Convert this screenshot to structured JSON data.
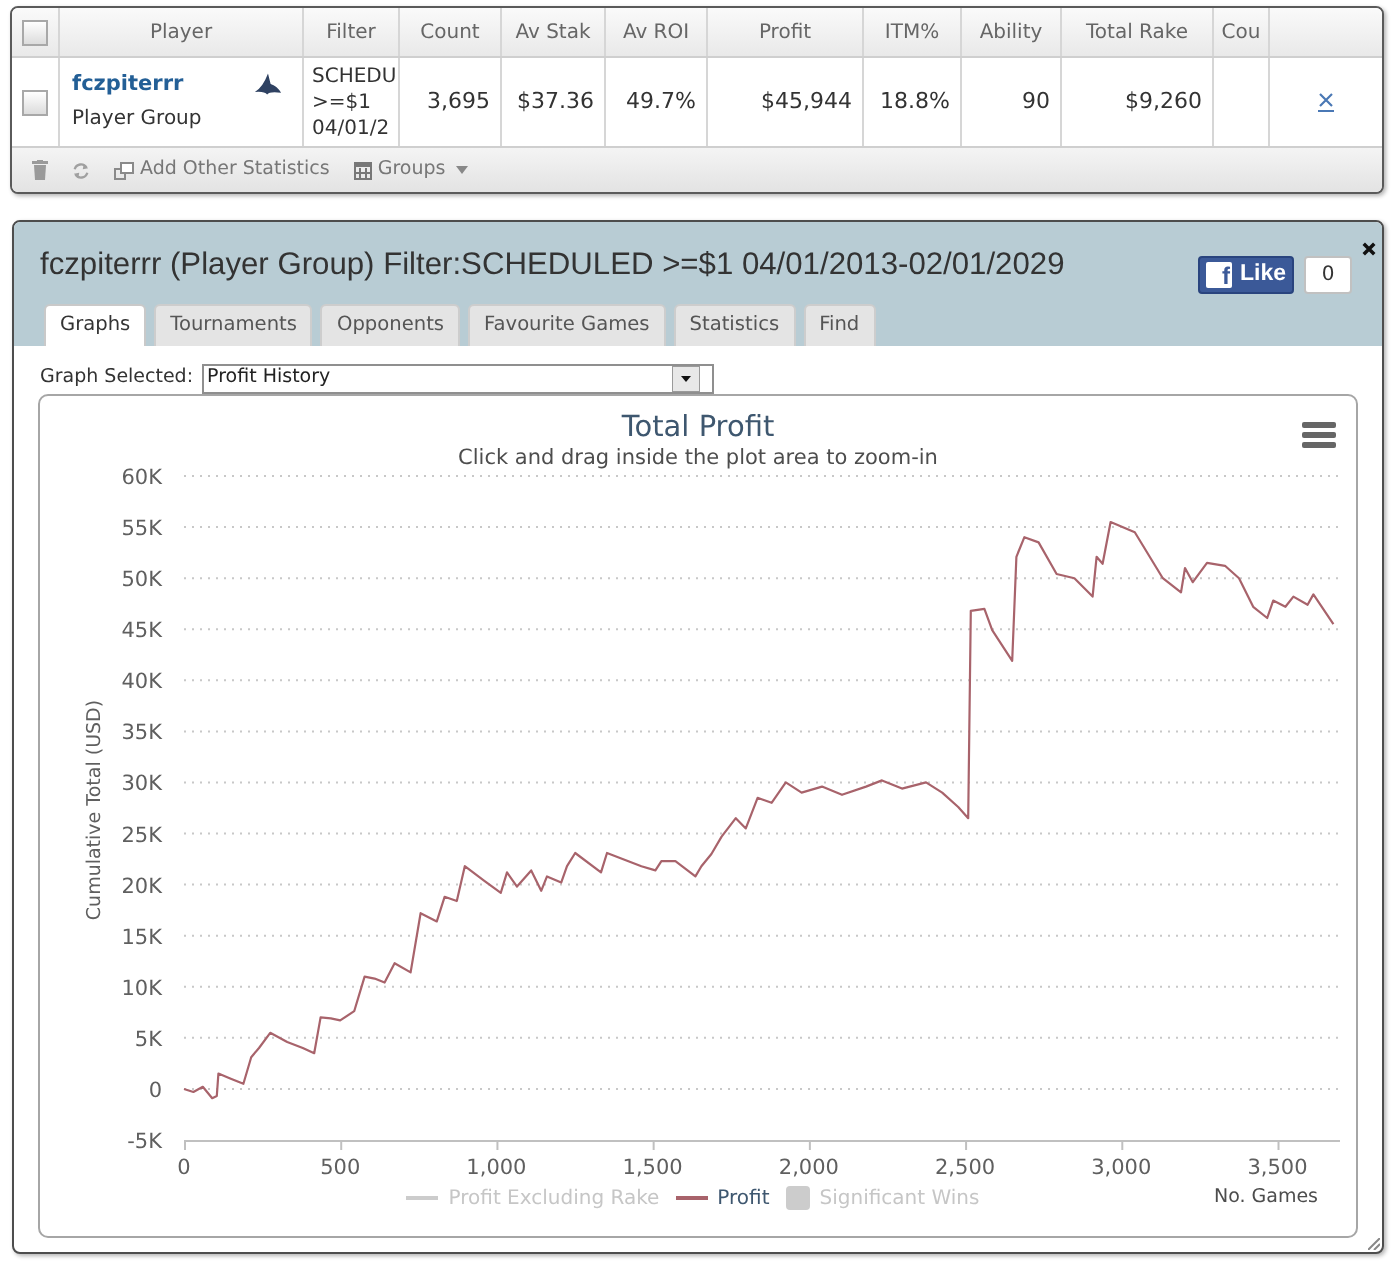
{
  "player_table": {
    "header_checkbox": {
      "checked": false
    },
    "columns": [
      "Player",
      "Filter",
      "Count",
      "Av Stak",
      "Av ROI",
      "Profit",
      "ITM%",
      "Ability",
      "Total Rake",
      "Cou"
    ],
    "rows": [
      {
        "checked": false,
        "player": "fczpiterrr",
        "group": "Player Group",
        "filter": [
          "SCHEDU",
          ">=$1",
          "04/01/2"
        ],
        "values": [
          "3,695",
          "$37.36",
          "49.7%",
          "$45,944",
          "18.8%",
          "90",
          "$9,260"
        ]
      }
    ],
    "toolbar": [
      {
        "kind": "delete"
      },
      {
        "kind": "refresh"
      },
      {
        "kind": "add",
        "label": "Add Other Statistics"
      },
      {
        "kind": "groups",
        "label": "Groups"
      }
    ]
  },
  "report": {
    "title": "fczpiterrr (Player Group) Filter:SCHEDULED >=$1 04/01/2013-02/01/2029",
    "like": {
      "logo": "f",
      "label": "Like",
      "count": "0"
    },
    "tabs": [
      {
        "label": "Graphs",
        "selected": true
      },
      {
        "label": "Tournaments",
        "selected": false
      },
      {
        "label": "Opponents",
        "selected": false
      },
      {
        "label": "Favourite Games",
        "selected": false
      },
      {
        "label": "Statistics",
        "selected": false
      },
      {
        "label": "Find",
        "selected": false
      }
    ],
    "graph_selector": {
      "label": "Graph Selected:",
      "value": "Profit History"
    },
    "chart": {
      "subtitle": "Click and drag inside the plot area to zoom-in",
      "legend": [
        {
          "kind": "line",
          "label": "Profit Excluding Rake",
          "visible": false
        },
        {
          "kind": "series",
          "visible": true
        },
        {
          "kind": "area",
          "label": "Significant Wins",
          "visible": false
        }
      ],
      "chart_data": {
        "type": "line",
        "title": "Total Profit",
        "xlabel": "No. Games",
        "ylabel": "Cumulative Total (USD)",
        "grid": true,
        "x": [
          0,
          30,
          60,
          90,
          105,
          110,
          150,
          190,
          215,
          240,
          276,
          330,
          380,
          417,
          437,
          470,
          500,
          545,
          578,
          610,
          642,
          674,
          725,
          757,
          809,
          834,
          873,
          899,
          960,
          1014,
          1034,
          1066,
          1111,
          1143,
          1162,
          1207,
          1226,
          1252,
          1335,
          1354,
          1464,
          1509,
          1528,
          1573,
          1637,
          1656,
          1688,
          1721,
          1766,
          1798,
          1836,
          1881,
          1926,
          1977,
          2042,
          2106,
          2183,
          2234,
          2298,
          2375,
          2427,
          2478,
          2510,
          2518,
          2562,
          2587,
          2651,
          2664,
          2690,
          2735,
          2793,
          2850,
          2908,
          2921,
          2940,
          2966,
          3043,
          3133,
          3191,
          3204,
          3229,
          3274,
          3332,
          3377,
          3422,
          3467,
          3486,
          3525,
          3551,
          3596,
          3615,
          3679
        ],
        "series": [
          {
            "name": "Profit",
            "color": "#a8636b",
            "values": [
              0,
              -300,
              200,
              -900,
              -700,
              1500,
              1000,
              500,
              3100,
              4000,
              5500,
              4600,
              4000,
              3500,
              7000,
              6900,
              6700,
              7600,
              11000,
              10800,
              10400,
              12300,
              11400,
              17200,
              16400,
              18800,
              18400,
              21800,
              20400,
              19200,
              21200,
              19800,
              21400,
              19400,
              20800,
              20200,
              21800,
              23100,
              21200,
              23100,
              21800,
              21400,
              22300,
              22300,
              20800,
              21800,
              23000,
              24700,
              26500,
              25500,
              28500,
              28000,
              30000,
              29000,
              29600,
              28800,
              29600,
              30200,
              29400,
              30000,
              29000,
              27600,
              26500,
              46800,
              47000,
              44900,
              41900,
              52100,
              54000,
              53500,
              50400,
              50000,
              48200,
              52100,
              51400,
              55500,
              54500,
              50000,
              48600,
              51000,
              49600,
              51500,
              51200,
              50000,
              47200,
              46100,
              47800,
              47200,
              48200,
              47400,
              48400,
              45500
            ]
          }
        ],
        "xlim": [
          0,
          3700
        ],
        "ylim": [
          -5000,
          60000
        ],
        "xticks": [
          {
            "value": 0,
            "label": "0"
          },
          {
            "value": 500,
            "label": "500"
          },
          {
            "value": 1000,
            "label": "1,000"
          },
          {
            "value": 1500,
            "label": "1,500"
          },
          {
            "value": 2000,
            "label": "2,000"
          },
          {
            "value": 2500,
            "label": "2,500"
          },
          {
            "value": 3000,
            "label": "3,000"
          },
          {
            "value": 3500,
            "label": "3,500"
          }
        ],
        "yticks": [
          {
            "value": -5000,
            "label": "-5K"
          },
          {
            "value": 0,
            "label": "0"
          },
          {
            "value": 5000,
            "label": "5K"
          },
          {
            "value": 10000,
            "label": "10K"
          },
          {
            "value": 15000,
            "label": "15K"
          },
          {
            "value": 20000,
            "label": "20K"
          },
          {
            "value": 25000,
            "label": "25K"
          },
          {
            "value": 30000,
            "label": "30K"
          },
          {
            "value": 35000,
            "label": "35K"
          },
          {
            "value": 40000,
            "label": "40K"
          },
          {
            "value": 45000,
            "label": "45K"
          },
          {
            "value": 50000,
            "label": "50K"
          },
          {
            "value": 55000,
            "label": "55K"
          },
          {
            "value": 60000,
            "label": "60K"
          }
        ]
      }
    }
  }
}
